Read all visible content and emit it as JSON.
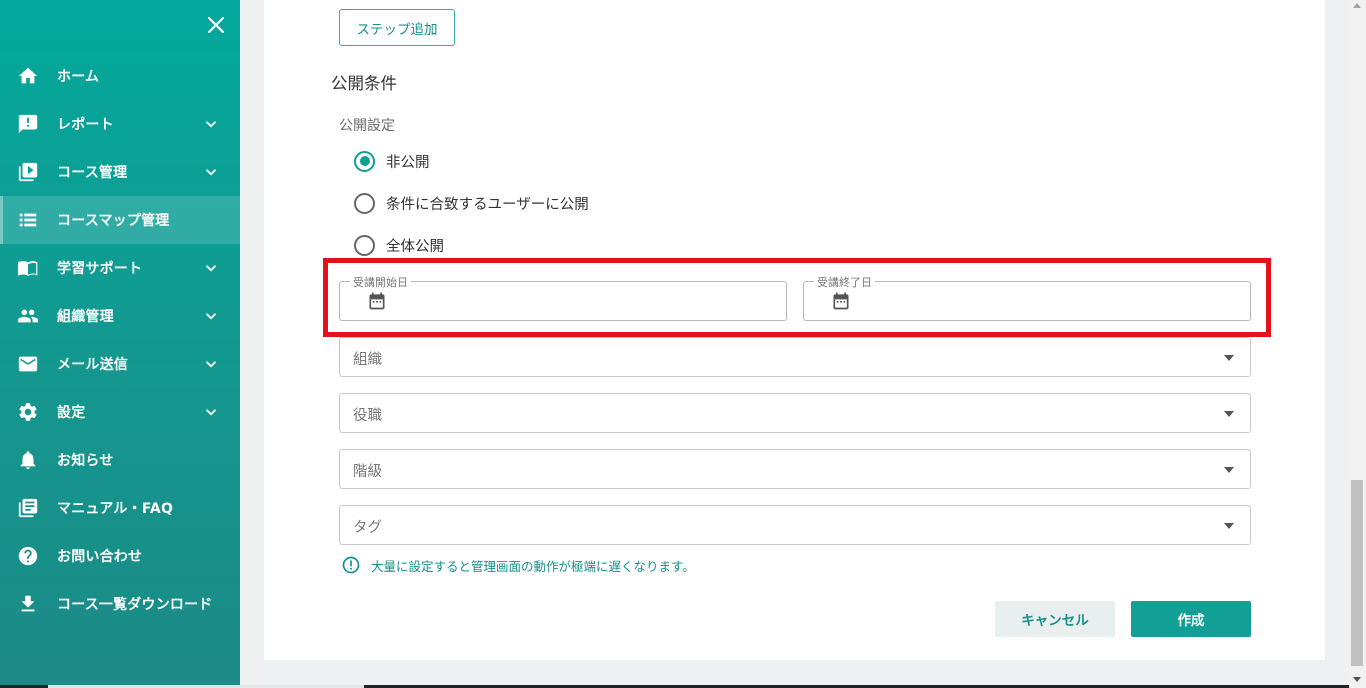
{
  "sidebar": {
    "items": [
      {
        "label": "ホーム",
        "icon": "home-icon"
      },
      {
        "label": "レポート",
        "icon": "report-icon",
        "expandable": true
      },
      {
        "label": "コース管理",
        "icon": "course-icon",
        "expandable": true
      },
      {
        "label": "コースマップ管理",
        "icon": "list-icon",
        "active": true
      },
      {
        "label": "学習サポート",
        "icon": "book-icon",
        "expandable": true
      },
      {
        "label": "組織管理",
        "icon": "people-icon",
        "expandable": true
      },
      {
        "label": "メール送信",
        "icon": "mail-icon",
        "expandable": true
      },
      {
        "label": "設定",
        "icon": "gear-icon",
        "expandable": true
      },
      {
        "label": "お知らせ",
        "icon": "bell-icon"
      },
      {
        "label": "マニュアル・FAQ",
        "icon": "manual-icon"
      },
      {
        "label": "お問い合わせ",
        "icon": "help-icon"
      },
      {
        "label": "コース一覧ダウンロード",
        "icon": "download-icon"
      }
    ]
  },
  "main": {
    "add_step_label": "ステップ追加",
    "section_title": "公開条件",
    "publish_setting_label": "公開設定",
    "radio_options": [
      {
        "label": "非公開",
        "checked": true
      },
      {
        "label": "条件に合致するユーザーに公開",
        "checked": false
      },
      {
        "label": "全体公開",
        "checked": false
      }
    ],
    "start_date_label": "受講開始日",
    "end_date_label": "受講終了日",
    "selects": [
      {
        "placeholder": "組織"
      },
      {
        "placeholder": "役職"
      },
      {
        "placeholder": "階級"
      },
      {
        "placeholder": "タグ"
      }
    ],
    "warning_text": "大量に設定すると管理画面の動作が極端に遅くなります。",
    "cancel_label": "キャンセル",
    "create_label": "作成"
  },
  "colors": {
    "accent": "#12a096",
    "highlight": "#e3111b"
  }
}
